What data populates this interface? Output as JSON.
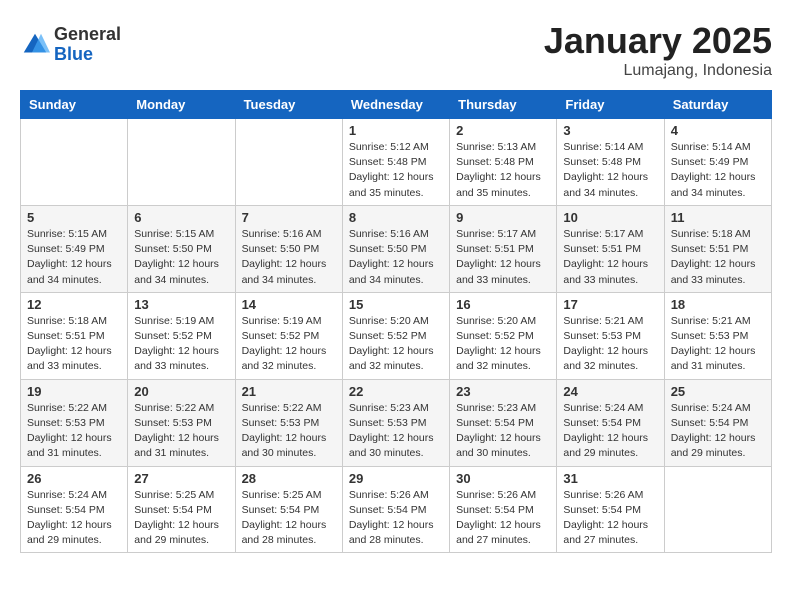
{
  "header": {
    "logo_general": "General",
    "logo_blue": "Blue",
    "month_title": "January 2025",
    "location": "Lumajang, Indonesia"
  },
  "days_of_week": [
    "Sunday",
    "Monday",
    "Tuesday",
    "Wednesday",
    "Thursday",
    "Friday",
    "Saturday"
  ],
  "weeks": [
    [
      {
        "day": "",
        "info": ""
      },
      {
        "day": "",
        "info": ""
      },
      {
        "day": "",
        "info": ""
      },
      {
        "day": "1",
        "info": "Sunrise: 5:12 AM\nSunset: 5:48 PM\nDaylight: 12 hours\nand 35 minutes."
      },
      {
        "day": "2",
        "info": "Sunrise: 5:13 AM\nSunset: 5:48 PM\nDaylight: 12 hours\nand 35 minutes."
      },
      {
        "day": "3",
        "info": "Sunrise: 5:14 AM\nSunset: 5:48 PM\nDaylight: 12 hours\nand 34 minutes."
      },
      {
        "day": "4",
        "info": "Sunrise: 5:14 AM\nSunset: 5:49 PM\nDaylight: 12 hours\nand 34 minutes."
      }
    ],
    [
      {
        "day": "5",
        "info": "Sunrise: 5:15 AM\nSunset: 5:49 PM\nDaylight: 12 hours\nand 34 minutes."
      },
      {
        "day": "6",
        "info": "Sunrise: 5:15 AM\nSunset: 5:50 PM\nDaylight: 12 hours\nand 34 minutes."
      },
      {
        "day": "7",
        "info": "Sunrise: 5:16 AM\nSunset: 5:50 PM\nDaylight: 12 hours\nand 34 minutes."
      },
      {
        "day": "8",
        "info": "Sunrise: 5:16 AM\nSunset: 5:50 PM\nDaylight: 12 hours\nand 34 minutes."
      },
      {
        "day": "9",
        "info": "Sunrise: 5:17 AM\nSunset: 5:51 PM\nDaylight: 12 hours\nand 33 minutes."
      },
      {
        "day": "10",
        "info": "Sunrise: 5:17 AM\nSunset: 5:51 PM\nDaylight: 12 hours\nand 33 minutes."
      },
      {
        "day": "11",
        "info": "Sunrise: 5:18 AM\nSunset: 5:51 PM\nDaylight: 12 hours\nand 33 minutes."
      }
    ],
    [
      {
        "day": "12",
        "info": "Sunrise: 5:18 AM\nSunset: 5:51 PM\nDaylight: 12 hours\nand 33 minutes."
      },
      {
        "day": "13",
        "info": "Sunrise: 5:19 AM\nSunset: 5:52 PM\nDaylight: 12 hours\nand 33 minutes."
      },
      {
        "day": "14",
        "info": "Sunrise: 5:19 AM\nSunset: 5:52 PM\nDaylight: 12 hours\nand 32 minutes."
      },
      {
        "day": "15",
        "info": "Sunrise: 5:20 AM\nSunset: 5:52 PM\nDaylight: 12 hours\nand 32 minutes."
      },
      {
        "day": "16",
        "info": "Sunrise: 5:20 AM\nSunset: 5:52 PM\nDaylight: 12 hours\nand 32 minutes."
      },
      {
        "day": "17",
        "info": "Sunrise: 5:21 AM\nSunset: 5:53 PM\nDaylight: 12 hours\nand 32 minutes."
      },
      {
        "day": "18",
        "info": "Sunrise: 5:21 AM\nSunset: 5:53 PM\nDaylight: 12 hours\nand 31 minutes."
      }
    ],
    [
      {
        "day": "19",
        "info": "Sunrise: 5:22 AM\nSunset: 5:53 PM\nDaylight: 12 hours\nand 31 minutes."
      },
      {
        "day": "20",
        "info": "Sunrise: 5:22 AM\nSunset: 5:53 PM\nDaylight: 12 hours\nand 31 minutes."
      },
      {
        "day": "21",
        "info": "Sunrise: 5:22 AM\nSunset: 5:53 PM\nDaylight: 12 hours\nand 30 minutes."
      },
      {
        "day": "22",
        "info": "Sunrise: 5:23 AM\nSunset: 5:53 PM\nDaylight: 12 hours\nand 30 minutes."
      },
      {
        "day": "23",
        "info": "Sunrise: 5:23 AM\nSunset: 5:54 PM\nDaylight: 12 hours\nand 30 minutes."
      },
      {
        "day": "24",
        "info": "Sunrise: 5:24 AM\nSunset: 5:54 PM\nDaylight: 12 hours\nand 29 minutes."
      },
      {
        "day": "25",
        "info": "Sunrise: 5:24 AM\nSunset: 5:54 PM\nDaylight: 12 hours\nand 29 minutes."
      }
    ],
    [
      {
        "day": "26",
        "info": "Sunrise: 5:24 AM\nSunset: 5:54 PM\nDaylight: 12 hours\nand 29 minutes."
      },
      {
        "day": "27",
        "info": "Sunrise: 5:25 AM\nSunset: 5:54 PM\nDaylight: 12 hours\nand 29 minutes."
      },
      {
        "day": "28",
        "info": "Sunrise: 5:25 AM\nSunset: 5:54 PM\nDaylight: 12 hours\nand 28 minutes."
      },
      {
        "day": "29",
        "info": "Sunrise: 5:26 AM\nSunset: 5:54 PM\nDaylight: 12 hours\nand 28 minutes."
      },
      {
        "day": "30",
        "info": "Sunrise: 5:26 AM\nSunset: 5:54 PM\nDaylight: 12 hours\nand 27 minutes."
      },
      {
        "day": "31",
        "info": "Sunrise: 5:26 AM\nSunset: 5:54 PM\nDaylight: 12 hours\nand 27 minutes."
      },
      {
        "day": "",
        "info": ""
      }
    ]
  ]
}
